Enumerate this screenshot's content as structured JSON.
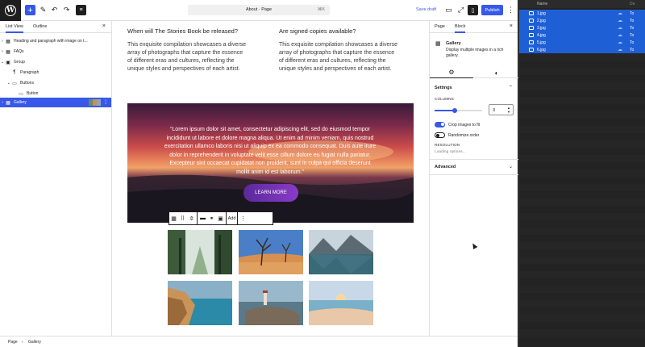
{
  "topbar": {
    "document_title": "About · Page",
    "shortcut": "⌘K",
    "save_draft": "Save draft",
    "publish": "Publish"
  },
  "list_view": {
    "tabs": [
      "List View",
      "Outline"
    ],
    "close": "×",
    "items": [
      {
        "label": "Heading and paragraph with image on t...",
        "icon": "pattern-icon",
        "glyph": "▦",
        "chevron": "›"
      },
      {
        "label": "FAQs",
        "icon": "pattern-icon",
        "glyph": "▦",
        "chevron": "›"
      },
      {
        "label": "Group",
        "icon": "group-icon",
        "glyph": "▣",
        "chevron": "⌄"
      },
      {
        "label": "Paragraph",
        "icon": "paragraph-icon",
        "glyph": "¶",
        "chevron": ""
      },
      {
        "label": "Buttons",
        "icon": "buttons-icon",
        "glyph": "▭",
        "chevron": "⌄"
      },
      {
        "label": "Button",
        "icon": "button-icon",
        "glyph": "▭",
        "chevron": ""
      },
      {
        "label": "Gallery",
        "icon": "gallery-icon",
        "glyph": "▦",
        "chevron": "›"
      }
    ]
  },
  "canvas": {
    "faq": [
      {
        "question": "When will The Stories Book be released?",
        "answer_lines": [
          "This exquisite compilation showcases a diverse",
          "array of photographs that capture the essence",
          "of different eras and cultures, reflecting the",
          "unique styles and perspectives of each artist."
        ]
      },
      {
        "question": "Are signed copies available?",
        "answer_lines": [
          "This exquisite compilation showcases a diverse",
          "array of photographs that capture the essence",
          "of different eras and cultures, reflecting the",
          "unique styles and perspectives of each artist."
        ]
      }
    ],
    "cover_quote_lines": [
      "“Lorem ipsum dolor sit amet, consectetur adipiscing elit, sed do eiusmod tempor",
      "incididunt ut labore et dolore magna aliqua. Ut enim ad minim veniam, quis nostrud",
      "exercitation ullamco laboris nisi ut aliquip ex ea commodo consequat. Duis aute irure",
      "dolor in reprehenderit in voluptate velit esse cillum dolore eu fugiat nulla pariatur.",
      "Excepteur sint occaecat cupidatat non proident, sunt in culpa qui officia deserunt",
      "mollit anim id est laborum.”"
    ],
    "cover_button": "LEARN MORE",
    "toolbar_add": "Add"
  },
  "inspector": {
    "tabs": [
      "Page",
      "Block"
    ],
    "close": "×",
    "block_name": "Gallery",
    "block_desc": "Display multiple images in a rich gallery.",
    "settings_title": "Settings",
    "columns_label": "COLUMNS",
    "columns_value": "3",
    "columns_fraction": 0.42,
    "crop_label": "Crop images to fit",
    "crop_on": true,
    "randomize_label": "Randomize order",
    "randomize_on": false,
    "resolution_label": "RESOLUTION",
    "resolution_value": "Loading options...",
    "advanced_title": "Advanced"
  },
  "breadcrumb": [
    "Page",
    "Gallery"
  ],
  "files": {
    "header_name": "Name",
    "header_date": "Da",
    "rows": [
      {
        "name": "1.jpg",
        "date": "To"
      },
      {
        "name": "2.jpg",
        "date": "To"
      },
      {
        "name": "3.jpg",
        "date": "To"
      },
      {
        "name": "4.jpg",
        "date": "To"
      },
      {
        "name": "5.jpg",
        "date": "To"
      },
      {
        "name": "6.jpg",
        "date": "To"
      }
    ]
  },
  "gallery_images": [
    {
      "subject": "forest-river",
      "colors": [
        "#3d5a3a",
        "#8fb08a",
        "#d8e4dc"
      ]
    },
    {
      "subject": "desert-trees",
      "colors": [
        "#4a7fc8",
        "#d89050",
        "#e0a060"
      ]
    },
    {
      "subject": "mountain-lake",
      "colors": [
        "#c8d4dc",
        "#5a6a72",
        "#3a6a78"
      ]
    },
    {
      "subject": "coastal-cliff",
      "colors": [
        "#8ab0c8",
        "#c8945a",
        "#2a8aa8"
      ]
    },
    {
      "subject": "lighthouse-rocks",
      "colors": [
        "#9ab8cc",
        "#7a6a5a",
        "#5a7a8a"
      ]
    },
    {
      "subject": "beach-sunset",
      "colors": [
        "#c8d8e8",
        "#e8c8a8",
        "#7ab0c8"
      ]
    }
  ]
}
